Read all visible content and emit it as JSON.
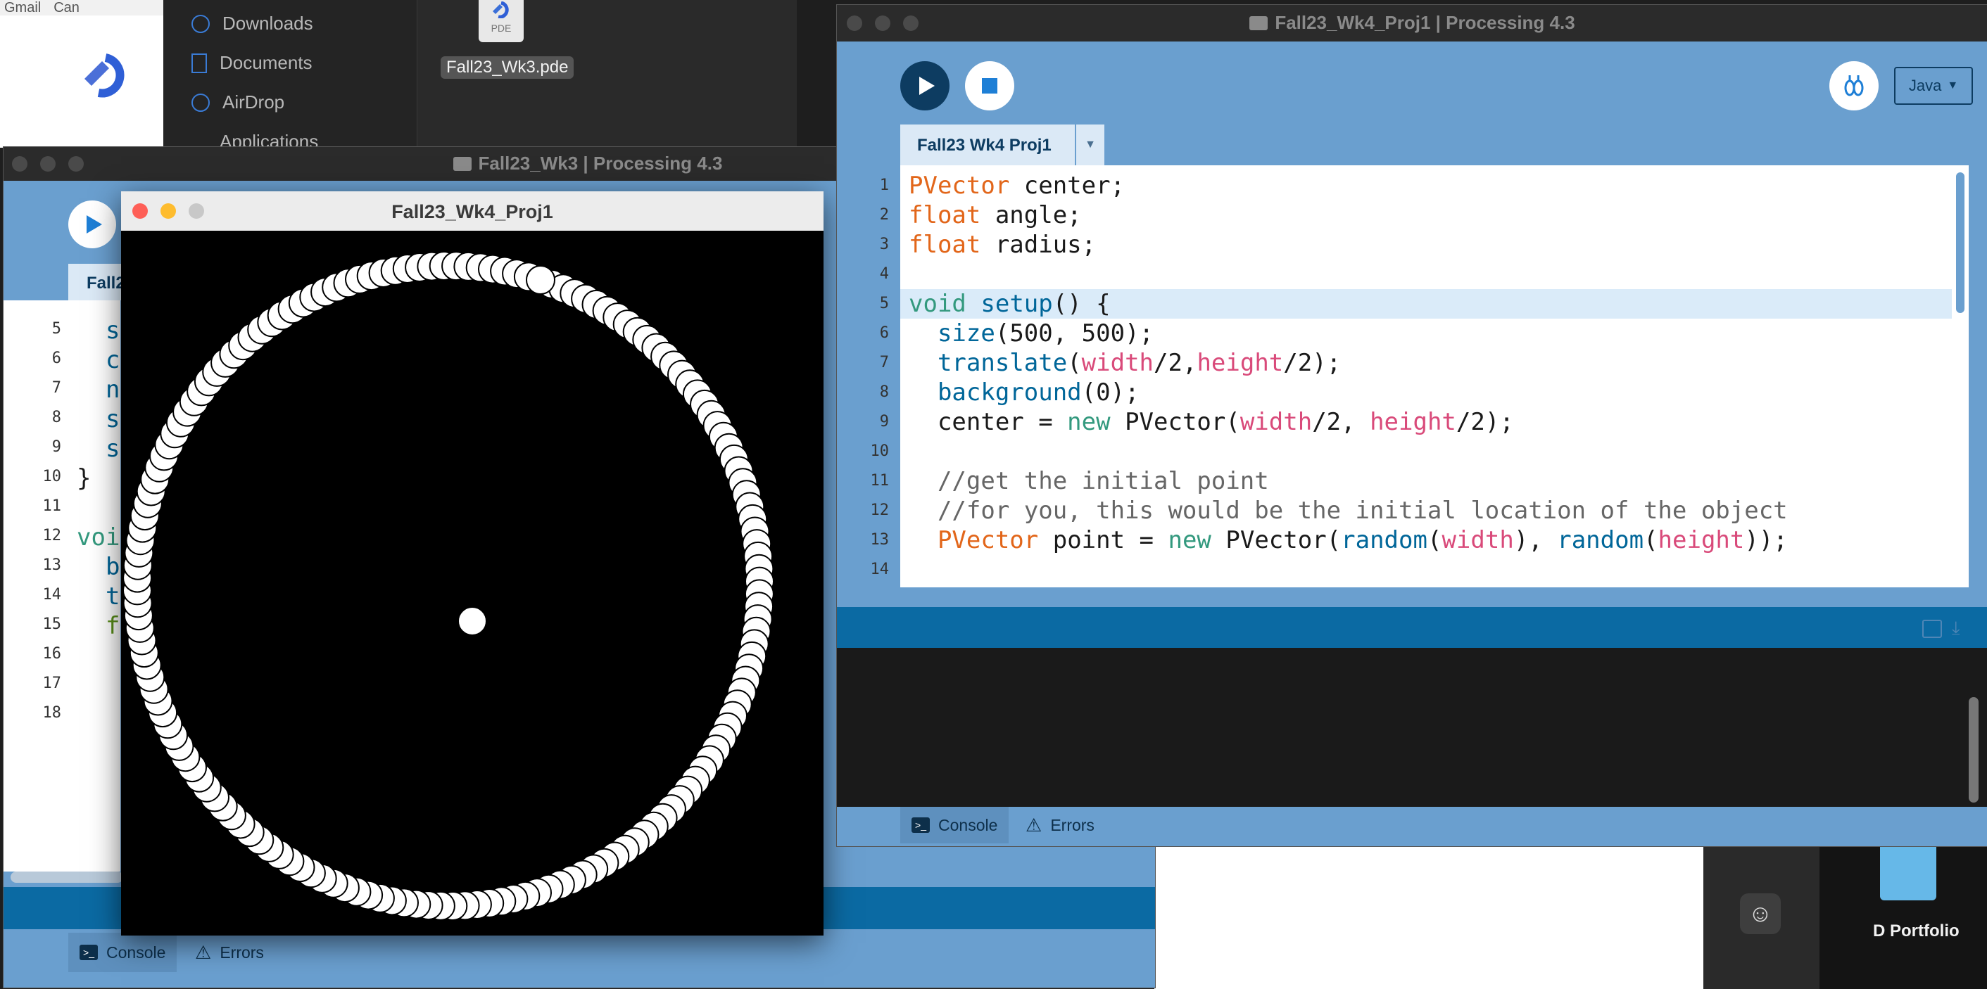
{
  "browser": {
    "tabs": [
      "Gmail",
      "Can"
    ]
  },
  "finder": {
    "sidebar": [
      "Downloads",
      "Documents",
      "AirDrop",
      "Applications"
    ],
    "file_name": "Fall23_Wk3.pde",
    "file_type": "PDE"
  },
  "wk3_window": {
    "title": "Fall23_Wk3 | Processing 4.3",
    "tab_partial": "Fall2",
    "line_numbers": [
      "5",
      "6",
      "7",
      "8",
      "9",
      "10",
      "11",
      "12",
      "13",
      "14",
      "15",
      "16",
      "17",
      "18"
    ],
    "code": [
      "  s",
      "  c",
      "  n",
      "  s",
      "  s",
      "}",
      "",
      "voi",
      "  b",
      "  t",
      "  f",
      "",
      "",
      ""
    ],
    "console_tab": "Console",
    "errors_tab": "Errors"
  },
  "sketch_window": {
    "title": "Fall23_Wk4_Proj1"
  },
  "main_window": {
    "title": "Fall23_Wk4_Proj1 | Processing 4.3",
    "tab_label": "Fall23 Wk4 Proj1",
    "mode_label": "Java",
    "line_numbers": [
      "1",
      "2",
      "3",
      "4",
      "5",
      "6",
      "7",
      "8",
      "9",
      "10",
      "11",
      "12",
      "13",
      "14"
    ],
    "console_tab": "Console",
    "errors_tab": "Errors",
    "colors": {
      "blue": "#6a9fcf",
      "dark_blue": "#0b6aa3",
      "editor_bg": "#ffffff",
      "console_bg": "#1a1a1a"
    }
  },
  "background": {
    "portfolio_label": "D Portfolio"
  }
}
